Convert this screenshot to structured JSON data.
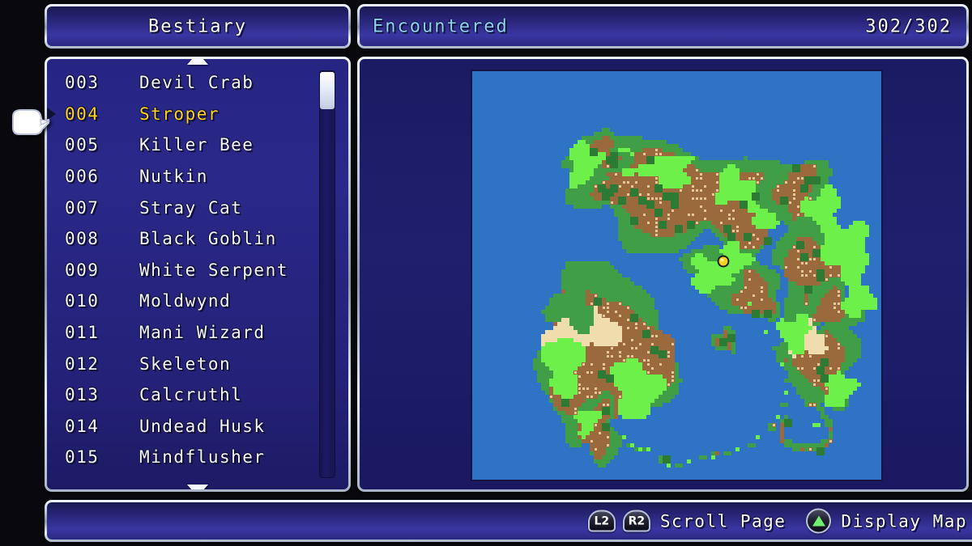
{
  "header": {
    "title": "Bestiary",
    "encountered_label": "Encountered",
    "encountered_current": "302",
    "encountered_separator": "/",
    "encountered_total": "302",
    "encountered_display": "302/302"
  },
  "list": {
    "selected_index": 1,
    "scroll_up_icon": "triangle-up-icon",
    "scroll_down_icon": "triangle-down-icon",
    "rows": [
      {
        "num": "003",
        "name": "Devil Crab"
      },
      {
        "num": "004",
        "name": "Stroper"
      },
      {
        "num": "005",
        "name": "Killer Bee"
      },
      {
        "num": "006",
        "name": "Nutkin"
      },
      {
        "num": "007",
        "name": "Stray Cat"
      },
      {
        "num": "008",
        "name": "Black Goblin"
      },
      {
        "num": "009",
        "name": "White Serpent"
      },
      {
        "num": "010",
        "name": "Moldwynd"
      },
      {
        "num": "011",
        "name": "Mani Wizard"
      },
      {
        "num": "012",
        "name": "Skeleton"
      },
      {
        "num": "013",
        "name": "Calcruthl"
      },
      {
        "num": "014",
        "name": "Undead Husk"
      },
      {
        "num": "015",
        "name": "Mindflusher"
      }
    ]
  },
  "map": {
    "marker_icon": "location-marker-icon",
    "marker_color": "#f5d21e",
    "ocean_color": "#2f73c4",
    "land_color": "#9a6a3c",
    "grass_color": "#3f9e46",
    "highlight_grass_color": "#6ef04a",
    "desert_color": "#f0ddae"
  },
  "footer": {
    "prompts": [
      {
        "glyph": "L2",
        "glyph_icon": "l2-shoulder-button-icon",
        "label": ""
      },
      {
        "glyph": "R2",
        "glyph_icon": "r2-shoulder-button-icon",
        "label": "Scroll Page"
      },
      {
        "glyph": "triangle",
        "glyph_icon": "triangle-button-icon",
        "label": "Display Map"
      }
    ],
    "scroll_page_label": "Scroll Page",
    "display_map_label": "Display Map"
  },
  "cursor": {
    "icon": "pointing-hand-cursor-icon"
  },
  "colors": {
    "panel_border": "#cfd8ea",
    "panel_fill": "#272584",
    "selected_text": "#ffd21e",
    "accent_cyan": "#8fd0ef",
    "text_white": "#f4f6ff"
  }
}
